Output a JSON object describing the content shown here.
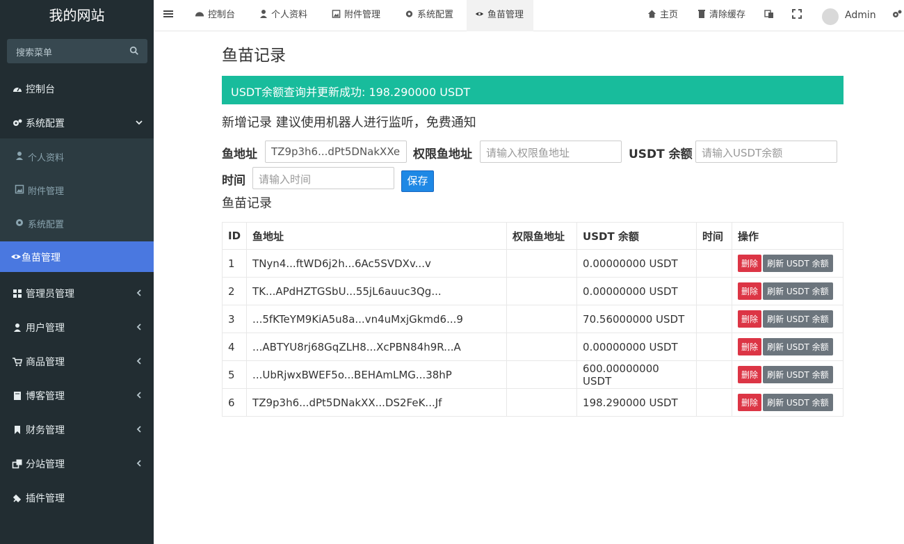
{
  "brand": "我的网站",
  "search": {
    "placeholder": "搜索菜单"
  },
  "sidebar": {
    "items": [
      {
        "label": "控制台"
      },
      {
        "label": "系统配置"
      },
      {
        "label": "管理员管理"
      },
      {
        "label": "用户管理"
      },
      {
        "label": "商品管理"
      },
      {
        "label": "博客管理"
      },
      {
        "label": "财务管理"
      },
      {
        "label": "分站管理"
      },
      {
        "label": "插件管理"
      }
    ],
    "submenu": [
      {
        "label": "个人资料"
      },
      {
        "label": "附件管理"
      },
      {
        "label": "系统配置"
      }
    ],
    "active": {
      "label": "鱼苗管理"
    }
  },
  "topbar": {
    "tabs": [
      {
        "label": "控制台"
      },
      {
        "label": "个人资料"
      },
      {
        "label": "附件管理"
      },
      {
        "label": "系统配置"
      },
      {
        "label": "鱼苗管理"
      }
    ],
    "home": "主页",
    "clear_cache": "清除缓存",
    "user": "Admin"
  },
  "main": {
    "title": "鱼苗记录",
    "alert": "USDT余额查询并更新成功: 198.290000 USDT",
    "subhead": "新增记录 建议使用机器人进行监听，免费通知",
    "form": {
      "addr_label": "鱼地址",
      "addr_value": "TZ9p3h6...dPt5DNakXXe",
      "perm_label": "权限鱼地址",
      "perm_placeholder": "请输入权限鱼地址",
      "bal_label": "USDT 余额",
      "bal_placeholder": "请输入USDT余额",
      "time_label": "时间",
      "time_placeholder": "请输入时间",
      "save": "保存"
    },
    "section": "鱼苗记录",
    "table": {
      "headers": [
        "ID",
        "鱼地址",
        "权限鱼地址",
        "USDT 余额",
        "时间",
        "操作"
      ],
      "rows": [
        {
          "id": "1",
          "addr": "TNyn4...ftWD6j2h...6Ac5SVDXv...v",
          "perm": "",
          "bal": "0.00000000 USDT",
          "time": ""
        },
        {
          "id": "2",
          "addr": "TK...APdHZTGSbU...55jL6auuc3Qg...",
          "perm": "",
          "bal": "0.00000000 USDT",
          "time": ""
        },
        {
          "id": "3",
          "addr": "...5fKTeYM9KiA5u8a...vn4uMxjGkmd6...9",
          "perm": "",
          "bal": "70.56000000 USDT",
          "time": ""
        },
        {
          "id": "4",
          "addr": "...ABTYU8rj68GqZLH8...XcPBN84h9R...A",
          "perm": "",
          "bal": "0.00000000 USDT",
          "time": ""
        },
        {
          "id": "5",
          "addr": "...UbRjwxBWEF5o...BEHAmLMG...38hP",
          "perm": "",
          "bal": "600.00000000 USDT",
          "time": ""
        },
        {
          "id": "6",
          "addr": "TZ9p3h6...dPt5DNakXX...DS2FeK...Jf",
          "perm": "",
          "bal": "198.290000 USDT",
          "time": ""
        }
      ],
      "del_label": "删除",
      "refresh_label": "刷新 USDT 余额"
    }
  }
}
